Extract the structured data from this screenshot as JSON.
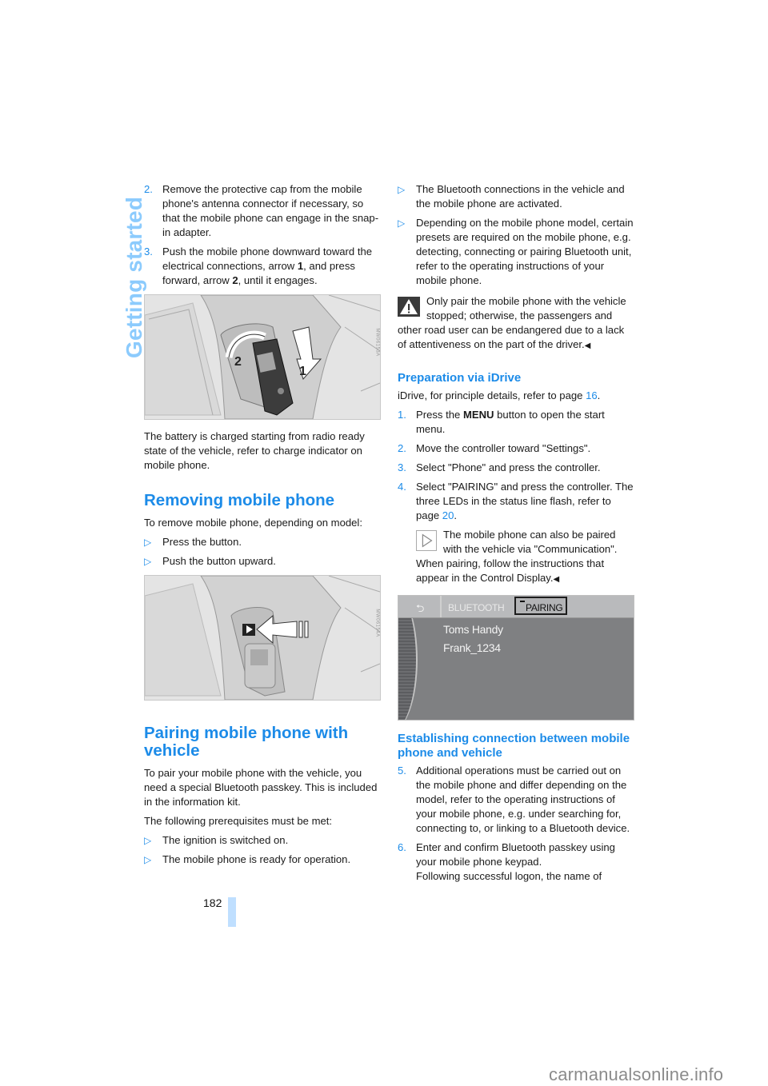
{
  "sidebar": {
    "section_title": "Getting started"
  },
  "page": {
    "number": "182"
  },
  "left_column": {
    "steps_top": [
      {
        "num": "2.",
        "text": "Remove the protective cap from the mobile phone's antenna connector if necessary, so that the mobile phone can engage in the snap-in adapter."
      },
      {
        "num": "3.",
        "text_before": "Push the mobile phone downward toward the electrical connections, arrow ",
        "bold1": "1",
        "text_mid": ", and press forward, arrow ",
        "bold2": "2",
        "text_after": ", until it engages."
      }
    ],
    "figure1": {
      "alt": "Mobile phone being inserted into snap-in adapter with arrows 1 and 2",
      "arrow1_label": "1",
      "arrow2_label": "2"
    },
    "battery_paragraph": "The battery is charged starting from radio ready state of the vehicle, refer to charge indicator on mobile phone.",
    "removing": {
      "heading": "Removing mobile phone",
      "intro": "To remove mobile phone, depending on model:",
      "bullets": [
        "Press the button.",
        "Push the button upward."
      ]
    },
    "figure2": {
      "alt": "Release button on snap-in adapter indicated by arrow"
    },
    "pairing": {
      "heading": "Pairing mobile phone with vehicle",
      "intro": "To pair your mobile phone with the vehicle, you need a special Bluetooth passkey. This is included in the information kit.",
      "prereq_intro": "The following prerequisites must be met:",
      "bullets": [
        "The ignition is switched on.",
        "The mobile phone is ready for operation."
      ]
    }
  },
  "right_column": {
    "bullets": [
      "The Bluetooth connections in the vehicle and the mobile phone are activated.",
      "Depending on the mobile phone model, certain presets are required on the mobile phone, e.g. detecting, connecting or pairing Bluetooth unit, refer to the operating instructions of your mobile phone."
    ],
    "warning": "Only pair the mobile phone with the vehicle stopped; otherwise, the passengers and other road user can be endangered due to a lack of attentiveness on the part of the driver.",
    "end_mark": "◀",
    "preparation": {
      "heading": "Preparation via iDrive",
      "intro_before": "iDrive, for principle details, refer to page ",
      "intro_link": "16",
      "intro_after": ".",
      "steps": [
        {
          "num": "1.",
          "before": "Press the ",
          "bold": "MENU",
          "after": " button to open the start menu."
        },
        {
          "num": "2.",
          "text": "Move the controller toward \"Settings\"."
        },
        {
          "num": "3.",
          "text": "Select \"Phone\" and press the controller."
        },
        {
          "num": "4.",
          "text": "Select \"PAIRING\" and press the controller. The three LEDs in the status line flash, refer to page ",
          "link": "20",
          "after": "."
        }
      ],
      "note": "The mobile phone can also be paired with the vehicle via \"Communication\". When pairing, follow the instructions that appear in the Control Display."
    },
    "display": {
      "tab_bluetooth": "BLUETOOTH",
      "tab_pairing": "PAIRING",
      "devices": [
        "Toms Handy",
        "Frank_1234"
      ]
    },
    "establishing": {
      "heading": "Establishing connection between mobile phone and vehicle",
      "steps": [
        {
          "num": "5.",
          "text": "Additional operations must be carried out on the mobile phone and differ depending on the model, refer to the operating instructions of your mobile phone, e.g. under searching for, connecting to, or linking to a Bluetooth device."
        },
        {
          "num": "6.",
          "text": "Enter and confirm Bluetooth passkey using your mobile phone keypad.",
          "text2": "Following successful logon, the name of"
        }
      ]
    }
  },
  "colors": {
    "accent": "#1c8be8",
    "side_title": "#8ccbfd",
    "page_bar": "#bfdfff"
  },
  "footer": {
    "watermark": "carmanualsonline.info"
  }
}
